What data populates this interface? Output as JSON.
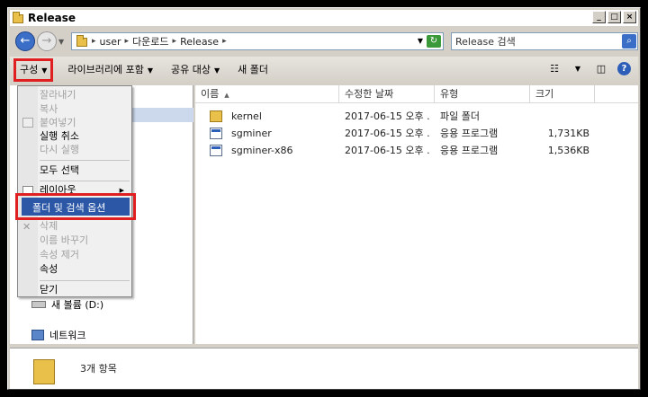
{
  "window": {
    "title": "Release",
    "buttons": [
      "_",
      "□",
      "×"
    ]
  },
  "address": {
    "crumbs": [
      "user",
      "다운로드",
      "Release"
    ],
    "search_placeholder": "Release 검색"
  },
  "commandbar": {
    "items": [
      "구성",
      "라이브러리에 포함",
      "공유 대상",
      "새 폴더"
    ]
  },
  "navpane": {
    "items": [
      {
        "label": "새 볼륨 (D:)",
        "icon": "drive-icon"
      },
      {
        "label": "네트워크",
        "icon": "network-icon"
      }
    ]
  },
  "columns": [
    "이름",
    "수정한 날짜",
    "유형",
    "크기"
  ],
  "files": [
    {
      "name": "kernel",
      "date": "2017-06-15 오후 ...",
      "type": "파일 폴더",
      "size": "",
      "icon": "folder-icon"
    },
    {
      "name": "sgminer",
      "date": "2017-06-15 오후 ...",
      "type": "응용 프로그램",
      "size": "1,731KB",
      "icon": "exe-icon"
    },
    {
      "name": "sgminer-x86",
      "date": "2017-06-15 오후 ...",
      "type": "응용 프로그램",
      "size": "1,536KB",
      "icon": "exe-icon"
    }
  ],
  "status": {
    "count": "3개 항목"
  },
  "menu": {
    "items": [
      {
        "label": "잘라내기",
        "disabled": true
      },
      {
        "label": "복사",
        "disabled": true
      },
      {
        "label": "붙여넣기",
        "disabled": true
      },
      {
        "label": "실행 취소",
        "disabled": false
      },
      {
        "label": "다시 실행",
        "disabled": true
      },
      {
        "label": "모두 선택",
        "disabled": false
      },
      {
        "label": "레이아웃",
        "disabled": false
      },
      {
        "label": "폴더 및 검색 옵션",
        "disabled": false,
        "selected": true
      },
      {
        "label": "삭제",
        "disabled": true
      },
      {
        "label": "이름 바꾸기",
        "disabled": true
      },
      {
        "label": "속성 제거",
        "disabled": true
      },
      {
        "label": "속성",
        "disabled": false
      },
      {
        "label": "닫기",
        "disabled": false
      }
    ]
  },
  "colors": {
    "highlight_red": "#e02020",
    "selection_blue": "#2b57a6",
    "folder_yellow": "#e8c04a"
  }
}
